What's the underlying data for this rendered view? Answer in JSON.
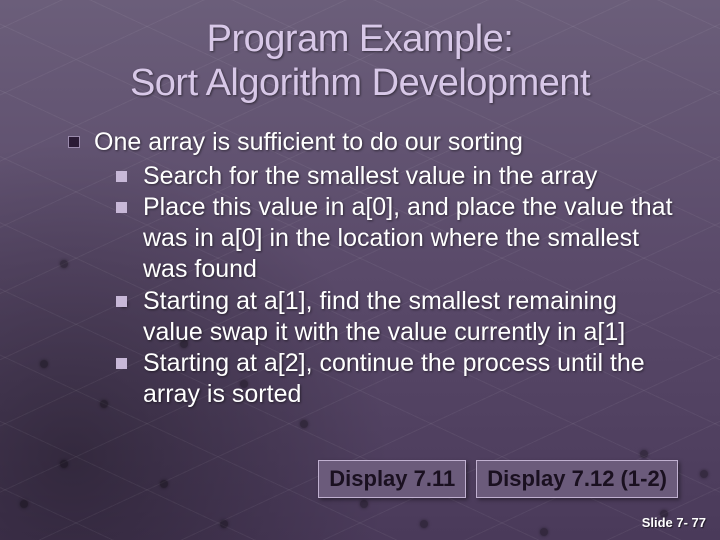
{
  "title_line1": "Program Example:",
  "title_line2": "Sort Algorithm Development",
  "top_point": "One array is sufficient to do our sorting",
  "sub_points": [
    "Search for the smallest value in the array",
    "Place this value in a[0], and place the value that was in a[0] in the location where the smallest was found",
    "Starting at a[1], find the smallest remaining value swap it with the value currently in a[1]",
    "Starting at a[2], continue the process until the array is sorted"
  ],
  "buttons": {
    "display_7_11": "Display 7.11",
    "display_7_12": "Display 7.12 (1-2)"
  },
  "footer": "Slide 7- 77"
}
